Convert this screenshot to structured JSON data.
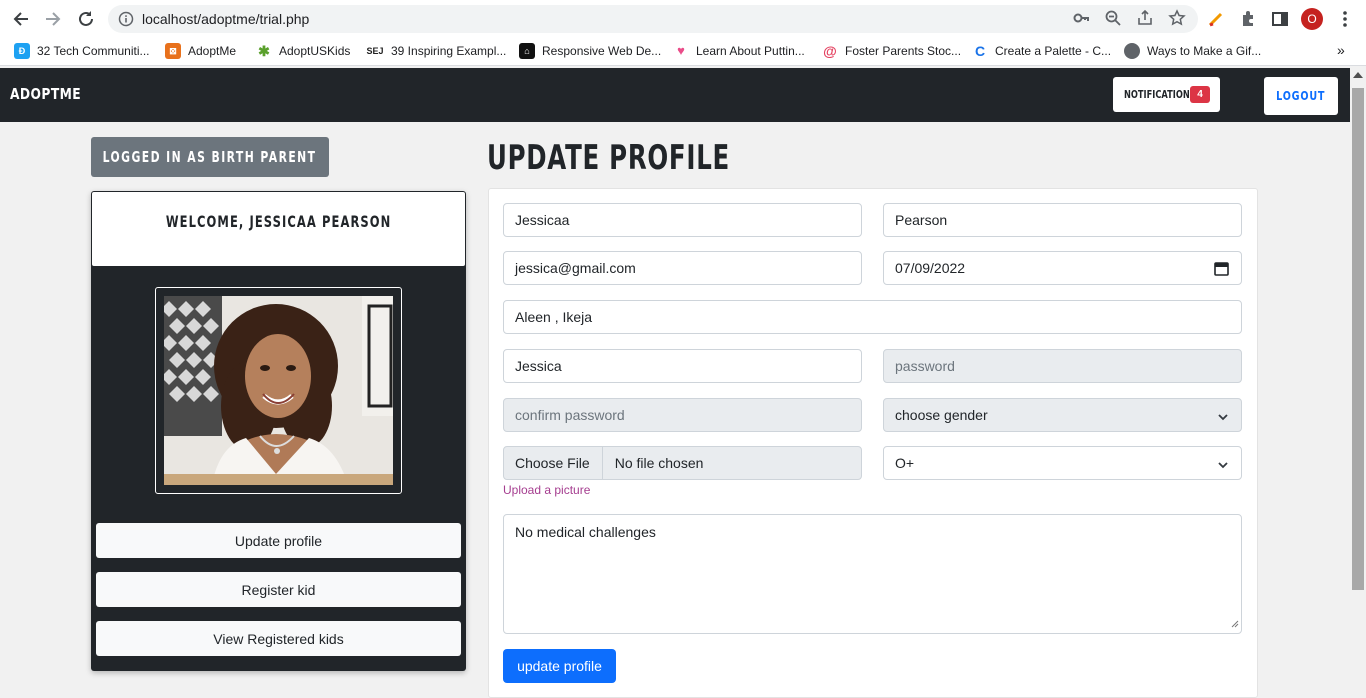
{
  "browser": {
    "url": "localhost/adoptme/trial.php",
    "profile_initial": "O",
    "bookmarks": [
      {
        "label": "32 Tech Communiti...",
        "icon": "b-icon",
        "color": "#1da1f2"
      },
      {
        "label": "AdoptMe",
        "icon": "adoptme-icon",
        "color": "#e8711c"
      },
      {
        "label": "AdoptUSKids",
        "icon": "kids-icon",
        "color": "#5aa02c"
      },
      {
        "label": "39 Inspiring Exampl...",
        "icon": "sej-icon",
        "color": "#222222"
      },
      {
        "label": "Responsive Web De...",
        "icon": "web-icon",
        "color": "#111111"
      },
      {
        "label": "Learn About Puttin...",
        "icon": "heart-icon",
        "color": "#ea4c89"
      },
      {
        "label": "Foster Parents Stoc...",
        "icon": "spiral-icon",
        "color": "#e4405f"
      },
      {
        "label": "Create a Palette - C...",
        "icon": "palette-icon",
        "color": "#1a73e8"
      },
      {
        "label": "Ways to Make a Gif...",
        "icon": "globe-icon",
        "color": "#5f6368"
      }
    ]
  },
  "navbar": {
    "brand": "ADOPTME",
    "notifications_label": "NOTIFICATIONS",
    "notifications_count": "4",
    "logout_label": "LOGOUT"
  },
  "sidebar": {
    "logged_in_as": "LOGGED IN AS BIRTH PARENT",
    "welcome": "WELCOME, JESSICAA PEARSON",
    "buttons": [
      "Update profile",
      "Register kid",
      "View Registered kids"
    ]
  },
  "form": {
    "title": "UPDATE PROFILE",
    "first_name": "Jessicaa",
    "last_name": "Pearson",
    "email": "jessica@gmail.com",
    "date": "07/09/2022",
    "address": "Aleen , Ikeja",
    "username": "Jessica",
    "password_placeholder": "password",
    "confirm_placeholder": "confirm password",
    "gender_select": "choose gender",
    "file_button": "Choose File",
    "file_status": "No file chosen",
    "blood_group": "O+",
    "upload_label": "Upload a picture",
    "medical": "No medical challenges",
    "submit": "update profile"
  },
  "colors": {
    "navbar": "#212529",
    "primary": "#0d6efd",
    "badge": "#dc3545",
    "secondary": "#6c757d",
    "upload_label": "#a53d8f"
  }
}
